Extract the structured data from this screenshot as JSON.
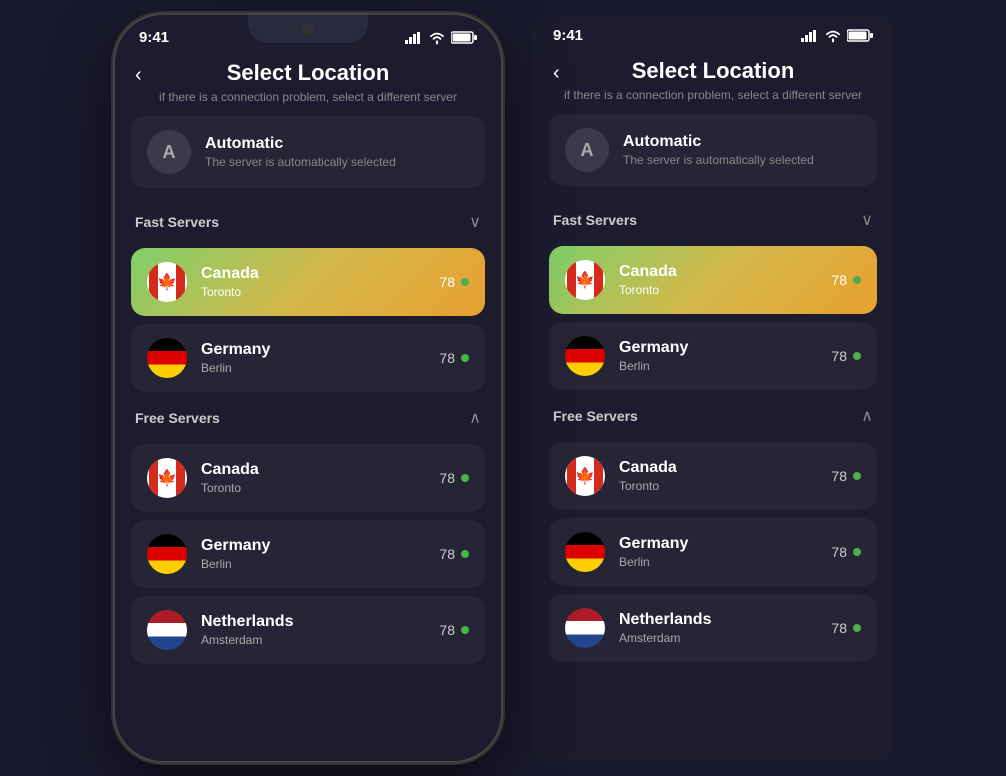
{
  "colors": {
    "bg": "#1c1c2e",
    "card": "#252535",
    "accent_green": "#4caf50",
    "gradient_start": "#7ecf6a",
    "gradient_mid": "#d4b84a",
    "gradient_end": "#e8a030"
  },
  "phone": {
    "status_time": "9:41",
    "back_icon": "‹",
    "title": "Select Location",
    "subtitle": "if there is a connection problem, select a different server",
    "auto_label": "A",
    "auto_name": "Automatic",
    "auto_desc": "The server is automatically selected",
    "fast_servers_label": "Fast Servers",
    "free_servers_label": "Free Servers",
    "fast_servers": [
      {
        "name": "Canada",
        "city": "Toronto",
        "score": "78",
        "highlighted": true
      },
      {
        "name": "Germany",
        "city": "Berlin",
        "score": "78",
        "highlighted": false
      }
    ],
    "free_servers": [
      {
        "name": "Canada",
        "city": "Toronto",
        "score": "78"
      },
      {
        "name": "Germany",
        "city": "Berlin",
        "score": "78"
      },
      {
        "name": "Netherlands",
        "city": "Amsterdam",
        "score": "78"
      }
    ]
  },
  "flat": {
    "status_time": "9:41",
    "back_icon": "‹",
    "title": "Select Location",
    "subtitle": "if there is a connection problem, select a different server",
    "auto_label": "A",
    "auto_name": "Automatic",
    "auto_desc": "The server is automatically selected",
    "fast_servers_label": "Fast Servers",
    "free_servers_label": "Free Servers",
    "fast_servers": [
      {
        "name": "Canada",
        "city": "Toronto",
        "score": "78",
        "highlighted": true
      },
      {
        "name": "Germany",
        "city": "Berlin",
        "score": "78",
        "highlighted": false
      }
    ],
    "free_servers": [
      {
        "name": "Canada",
        "city": "Toronto",
        "score": "78"
      },
      {
        "name": "Germany",
        "city": "Berlin",
        "score": "78"
      },
      {
        "name": "Netherlands",
        "city": "Amsterdam",
        "score": "78"
      }
    ]
  }
}
